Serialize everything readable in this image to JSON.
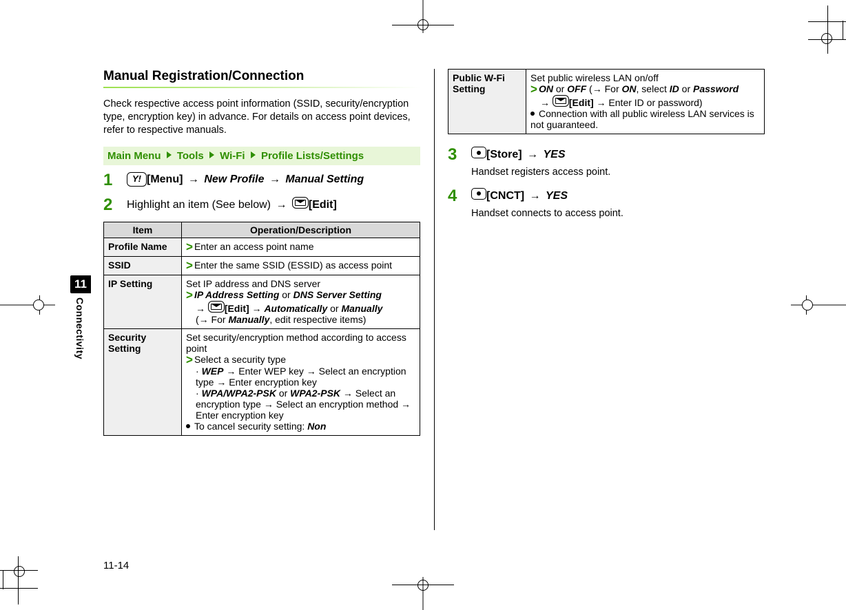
{
  "tab": {
    "number": "11",
    "name": "Connectivity"
  },
  "page_number": "11-14",
  "section_title": "Manual Registration/Connection",
  "lead": "Check respective access point information (SSID, security/encryption type, encryption key) in advance. For details on access point devices, refer to respective manuals.",
  "breadcrumb": [
    "Main Menu",
    "Tools",
    "Wi-Fi",
    "Profile Lists/Settings"
  ],
  "steps": {
    "s1": {
      "num": "1",
      "key_label": "Y!",
      "menu_label": "[Menu]",
      "arrow": "→",
      "new_profile": "New Profile",
      "manual_setting": "Manual Setting"
    },
    "s2": {
      "num": "2",
      "text_a": "Highlight an item (See below) ",
      "arrow": "→",
      "edit_label": "[Edit]"
    },
    "s3": {
      "num": "3",
      "store_label": "[Store]",
      "arrow": "→",
      "yes": "YES",
      "sub": "Handset registers access point."
    },
    "s4": {
      "num": "4",
      "cnct_label": "[CNCT]",
      "arrow": "→",
      "yes": "YES",
      "sub": "Handset connects to access point."
    }
  },
  "table_headers": {
    "item": "Item",
    "op": "Operation/Description"
  },
  "table": {
    "profile_name": {
      "item": "Profile Name",
      "op": "Enter an access point name"
    },
    "ssid": {
      "item": "SSID",
      "op": "Enter the same SSID (ESSID) as access point"
    },
    "ip": {
      "item": "IP Setting",
      "line1": "Set IP address and DNS server",
      "ip_addr": "IP Address Setting",
      "or": " or ",
      "dns": "DNS Server Setting",
      "edit": "[Edit]",
      "arrow": "→",
      "auto": "Automatically",
      "manual": "Manually",
      "for": "(→ For ",
      "manual2": "Manually",
      "edit_items": ", edit respective items)"
    },
    "security": {
      "item": "Security Setting",
      "line1": "Set security/encryption method according to access point",
      "select": "Select a security type",
      "wep": "WEP",
      "wep_tail": " → Enter WEP key → Select an encryption type → Enter encryption key",
      "wpa": "WPA/WPA2-PSK",
      "or": " or ",
      "wpa2": "WPA2-PSK",
      "wpa_tail": " → Select an encryption type → Select an encryption method → Enter encryption key",
      "cancel": "To cancel security setting: ",
      "non": "Non"
    },
    "public": {
      "item": "Public W-Fi Setting",
      "line1": "Set public wireless LAN on/off",
      "on": "ON",
      "or": " or ",
      "off": "OFF",
      "for_on_a": " (→ For ",
      "on2": "ON",
      "select": ", select ",
      "id": "ID",
      "or2": " or ",
      "password": "Password",
      "arrow": " → ",
      "edit": "[Edit]",
      "enter": " → Enter ID or password)",
      "note": "Connection with all public wireless LAN services is not guaranteed."
    }
  }
}
